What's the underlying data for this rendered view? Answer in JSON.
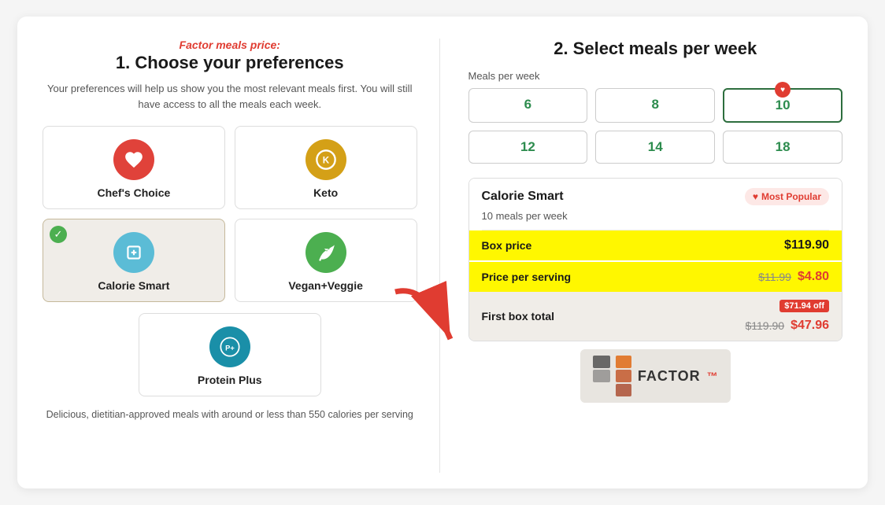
{
  "left": {
    "subtitle": "Factor meals price:",
    "title": "1. Choose your preferences",
    "description": "Your preferences will help us show you the most relevant meals first. You will still have access to all the meals each week.",
    "preferences": [
      {
        "id": "chefs-choice",
        "label": "Chef's Choice",
        "icon": "♥",
        "iconClass": "icon-chefs",
        "selected": false
      },
      {
        "id": "keto",
        "label": "Keto",
        "icon": "K",
        "iconClass": "icon-keto",
        "selected": false
      },
      {
        "id": "calorie-smart",
        "label": "Calorie Smart",
        "icon": "⊞",
        "iconClass": "icon-calorie",
        "selected": true
      },
      {
        "id": "vegan-veggie",
        "label": "Vegan+Veggie",
        "icon": "🌿",
        "iconClass": "icon-vegan",
        "selected": false
      },
      {
        "id": "protein-plus",
        "label": "Protein Plus",
        "icon": "P+",
        "iconClass": "icon-protein",
        "selected": false
      }
    ],
    "footer_note": "Delicious, dietitian-approved meals with around or less than 550 calories per serving"
  },
  "right": {
    "title": "2. Select meals per week",
    "meals_label": "Meals per week",
    "meal_options": [
      {
        "value": "6",
        "active": false
      },
      {
        "value": "8",
        "active": false
      },
      {
        "value": "10",
        "active": true,
        "popular": true
      },
      {
        "value": "12",
        "active": false
      },
      {
        "value": "14",
        "active": false
      },
      {
        "value": "18",
        "active": false
      }
    ],
    "pricing": {
      "plan_name": "Calorie Smart",
      "most_popular_label": "Most Popular",
      "meals_per_week": "10 meals per week",
      "box_price_label": "Box price",
      "box_price_value": "$119.90",
      "per_serving_label": "Price per serving",
      "per_serving_old": "$11.99",
      "per_serving_new": "$4.80",
      "first_box_label": "First box total",
      "first_box_off": "$71.94 off",
      "first_box_old": "$119.90",
      "first_box_new": "$47.96"
    }
  },
  "colors": {
    "red": "#e03c31",
    "green": "#2d8c4e",
    "yellow": "#fff700",
    "beige": "#f0ede8"
  }
}
